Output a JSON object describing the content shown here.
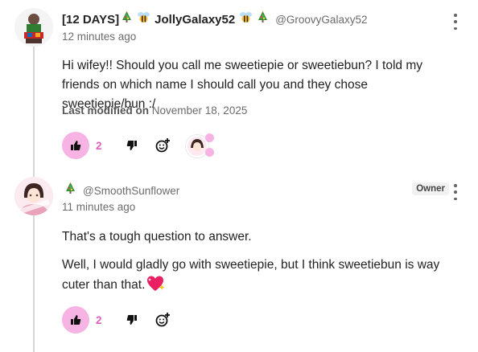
{
  "comments": [
    {
      "tag": "[12 DAYS]",
      "display_name": "JollyGalaxy52",
      "handle": "@GroovyGalaxy52",
      "time": "12 minutes ago",
      "paragraphs": [
        "Hi wifey!! Should you call me sweetiepie or sweetiebun? I told my friends on which name I should call you and they chose sweetiepie/bun :/"
      ],
      "last_modified_label": "Last modified on",
      "last_modified_date": "November 18, 2025",
      "likes": "2",
      "icons": [
        "tree-icon",
        "bee-icon",
        "bee-icon",
        "tree-icon"
      ]
    },
    {
      "handle": "@SmoothSunflower",
      "owner_badge": "Owner",
      "time": "11 minutes ago",
      "paragraphs": [
        "That's a tough question to answer.",
        "Well, I would gladly go with sweetiepie, but I think sweetiebun is way cuter than that."
      ],
      "likes": "2",
      "icons": [
        "tree-icon",
        "sparkle-heart-icon"
      ]
    }
  ],
  "colors": {
    "like_bg": "#f7b3e3",
    "like_text": "#e060c0",
    "thread_line": "#d6d6d6"
  }
}
